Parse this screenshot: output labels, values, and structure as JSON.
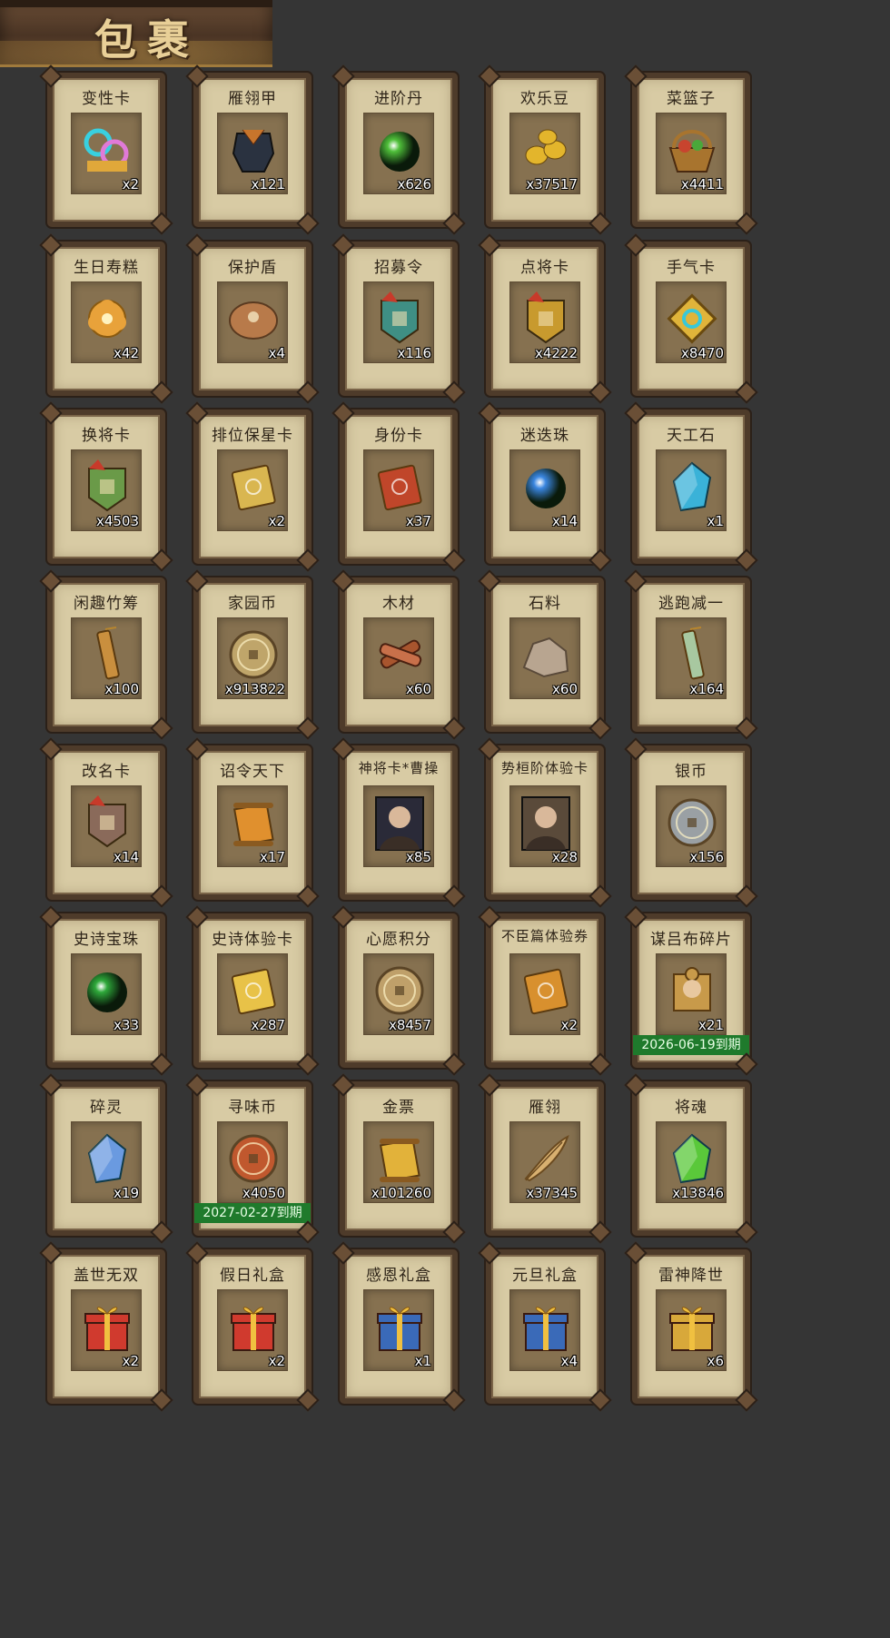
{
  "title": "包裹",
  "items": [
    {
      "name": "变性卡",
      "qty": "x2",
      "icon": "gender-swap-card-icon",
      "color": "#e07ad8",
      "shape": "gem"
    },
    {
      "name": "雁翎甲",
      "qty": "x121",
      "icon": "armor-icon",
      "color": "#c8752c",
      "shape": "armor"
    },
    {
      "name": "进阶丹",
      "qty": "x626",
      "icon": "green-pill-icon",
      "color": "#4fbf3a",
      "shape": "orb"
    },
    {
      "name": "欢乐豆",
      "qty": "x37517",
      "icon": "gold-beans-icon",
      "color": "#e3b52c",
      "shape": "beans"
    },
    {
      "name": "菜篮子",
      "qty": "x4411",
      "icon": "vegetable-basket-icon",
      "color": "#c8442e",
      "shape": "basket"
    },
    {
      "name": "生日寿糕",
      "qty": "x42",
      "icon": "birthday-cake-icon",
      "color": "#e8a23a",
      "shape": "flower"
    },
    {
      "name": "保护盾",
      "qty": "x4",
      "icon": "shield-icon",
      "color": "#b87a4a",
      "shape": "shield"
    },
    {
      "name": "招募令",
      "qty": "x116",
      "icon": "recruit-token-icon",
      "color": "#3f8f84",
      "shape": "token"
    },
    {
      "name": "点将卡",
      "qty": "x4222",
      "icon": "general-card-icon",
      "color": "#c89a2e",
      "shape": "token"
    },
    {
      "name": "手气卡",
      "qty": "x8470",
      "icon": "luck-card-icon",
      "color": "#e0b43a",
      "shape": "diamond"
    },
    {
      "name": "换将卡",
      "qty": "x4503",
      "icon": "swap-general-card-icon",
      "color": "#6a9a48",
      "shape": "token"
    },
    {
      "name": "排位保星卡",
      "qty": "x2",
      "icon": "rank-star-card-icon",
      "color": "#d9b650",
      "shape": "card"
    },
    {
      "name": "身份卡",
      "qty": "x37",
      "icon": "identity-mask-card-icon",
      "color": "#c0462a",
      "shape": "card"
    },
    {
      "name": "迷迭珠",
      "qty": "x14",
      "icon": "blue-orb-icon",
      "color": "#3a86e0",
      "shape": "orb"
    },
    {
      "name": "天工石",
      "qty": "x1",
      "icon": "crystal-stone-icon",
      "color": "#3ab2d8",
      "shape": "crystal"
    },
    {
      "name": "闲趣竹筹",
      "qty": "x100",
      "icon": "bamboo-tally-icon",
      "color": "#c98f3e",
      "shape": "tally"
    },
    {
      "name": "家园币",
      "qty": "x913822",
      "icon": "home-coin-icon",
      "color": "#bfa56a",
      "shape": "coin"
    },
    {
      "name": "木材",
      "qty": "x60",
      "icon": "wood-icon",
      "color": "#a8552e",
      "shape": "wood"
    },
    {
      "name": "石料",
      "qty": "x60",
      "icon": "stone-icon",
      "color": "#b8a590",
      "shape": "rock"
    },
    {
      "name": "逃跑减一",
      "qty": "x164",
      "icon": "escape-pendant-icon",
      "color": "#a8c8a0",
      "shape": "tally"
    },
    {
      "name": "改名卡",
      "qty": "x14",
      "icon": "rename-card-icon",
      "color": "#8a6a5a",
      "shape": "token"
    },
    {
      "name": "诏令天下",
      "qty": "x17",
      "icon": "imperial-edict-icon",
      "color": "#e0902e",
      "shape": "scroll"
    },
    {
      "name": "神将卡*曹操",
      "qty": "x85",
      "icon": "cao-cao-portrait-icon",
      "color": "#2a2a38",
      "shape": "portrait"
    },
    {
      "name": "势桓阶体验卡",
      "qty": "x28",
      "icon": "trial-general-portrait-icon",
      "color": "#5a4a3a",
      "shape": "portrait"
    },
    {
      "name": "银币",
      "qty": "x156",
      "icon": "silver-coins-icon",
      "color": "#9aa0a4",
      "shape": "coin"
    },
    {
      "name": "史诗宝珠",
      "qty": "x33",
      "icon": "green-epic-orb-icon",
      "color": "#2ea83a",
      "shape": "orb"
    },
    {
      "name": "史诗体验卡",
      "qty": "x287",
      "icon": "epic-trial-card-icon",
      "color": "#e8c248",
      "shape": "card"
    },
    {
      "name": "心愿积分",
      "qty": "x8457",
      "icon": "heart-coin-icon",
      "color": "#bfa06a",
      "shape": "coin"
    },
    {
      "name": "不臣篇体验券",
      "qty": "x2",
      "icon": "trial-ticket-icon",
      "color": "#d8902e",
      "shape": "card"
    },
    {
      "name": "谋吕布碎片",
      "qty": "x21",
      "icon": "lu-bu-fragment-icon",
      "color": "#c89a4a",
      "shape": "puzzle",
      "expiry": "2026-06-19到期"
    },
    {
      "name": "碎灵",
      "qty": "x19",
      "icon": "spirit-shard-icon",
      "color": "#6a9ae0",
      "shape": "crystal"
    },
    {
      "name": "寻味币",
      "qty": "x4050",
      "icon": "flavor-coin-icon",
      "color": "#c0582e",
      "shape": "coin",
      "expiry": "2027-02-27到期"
    },
    {
      "name": "金票",
      "qty": "x101260",
      "icon": "gold-ticket-icon",
      "color": "#e2b23a",
      "shape": "scroll"
    },
    {
      "name": "雁翎",
      "qty": "x37345",
      "icon": "feather-icon",
      "color": "#d8b070",
      "shape": "feather"
    },
    {
      "name": "将魂",
      "qty": "x13846",
      "icon": "general-soul-icon",
      "color": "#5ac83a",
      "shape": "crystal"
    },
    {
      "name": "盖世无双",
      "qty": "x2",
      "icon": "red-gift-box-icon",
      "color": "#d03a2e",
      "shape": "gift"
    },
    {
      "name": "假日礼盒",
      "qty": "x2",
      "icon": "holiday-gift-box-icon",
      "color": "#d03a2e",
      "shape": "gift"
    },
    {
      "name": "感恩礼盒",
      "qty": "x1",
      "icon": "blue-gift-box-icon",
      "color": "#3a6ab8",
      "shape": "gift"
    },
    {
      "name": "元旦礼盒",
      "qty": "x4",
      "icon": "new-year-gift-box-icon",
      "color": "#3a6ab8",
      "shape": "gift"
    },
    {
      "name": "雷神降世",
      "qty": "x6",
      "icon": "gold-gift-box-icon",
      "color": "#d8a83a",
      "shape": "gift"
    }
  ]
}
